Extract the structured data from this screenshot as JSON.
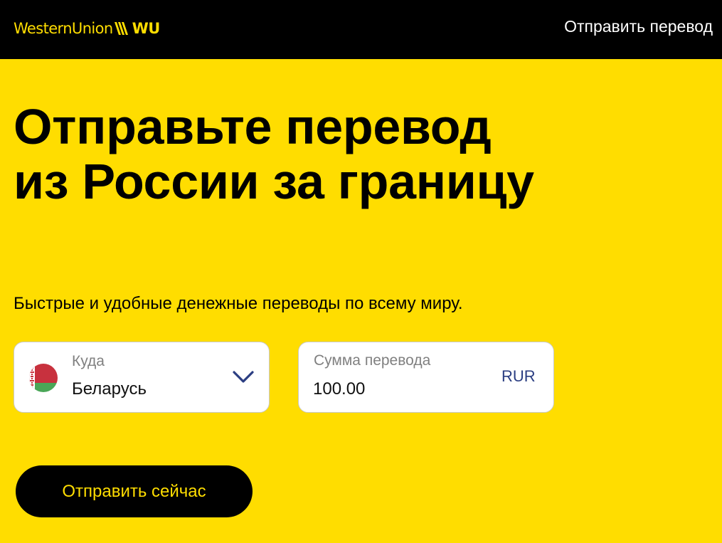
{
  "header": {
    "logo_text": "WesternUnion",
    "logo_abbr": "WU",
    "send_link_label": "Отправить перевод"
  },
  "hero": {
    "title": "Отправьте перевод из России за границу",
    "subtitle": "Быстрые и удобные денежные переводы по всему миру."
  },
  "form": {
    "destination": {
      "label": "Куда",
      "value": "Беларусь",
      "flag_icon": "belarus-flag-icon",
      "toggle_icon": "chevron-down-icon"
    },
    "amount": {
      "label": "Сумма перевода",
      "value": "100.00",
      "currency": "RUR"
    },
    "submit_label": "Отправить сейчас"
  },
  "colors": {
    "brand_yellow": "#ffdd00",
    "header_black": "#000000",
    "currency_blue": "#2b3e82",
    "label_gray": "#808080"
  }
}
